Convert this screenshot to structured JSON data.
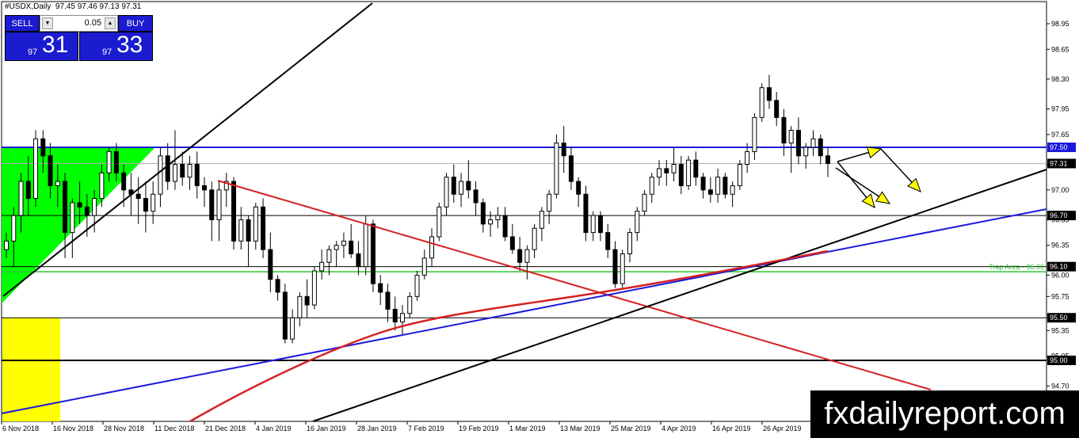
{
  "header": {
    "symbol": "#USDX,Daily",
    "ohlc": "97.45 97.46 97.13 97.31"
  },
  "trade_panel": {
    "sell_label": "SELL",
    "buy_label": "BUY",
    "lot_value": "0.05",
    "sell_price_prefix": "97",
    "sell_price_big": "31",
    "buy_price_prefix": "97",
    "buy_price_big": "33"
  },
  "brand": "fxdailyreport.com",
  "colors": {
    "bull_candle": "#ffffff",
    "bear_candle": "#000000",
    "resistance_line": "#1a1adb",
    "ma_line": "#d42020",
    "trendline": "#000000",
    "green_zone": "#00ff00",
    "yellow_zone": "#ffff00",
    "arrow_fill": "#ffff00"
  },
  "chart_data": {
    "type": "candlestick",
    "symbol": "#USDX",
    "timeframe": "Daily",
    "y_ticks": [
      "98.95",
      "98.65",
      "98.30",
      "97.95",
      "97.65",
      "97.30",
      "97.00",
      "96.65",
      "96.35",
      "96.00",
      "95.75",
      "95.35",
      "95.05",
      "94.70"
    ],
    "y_tick_values": [
      98.95,
      98.65,
      98.3,
      97.95,
      97.65,
      97.3,
      97.0,
      96.65,
      96.35,
      96.0,
      95.75,
      95.35,
      95.05,
      94.7
    ],
    "ylim": [
      94.6,
      99.25
    ],
    "x_ticks": [
      "6 Nov 2018",
      "16 Nov 2018",
      "28 Nov 2018",
      "11 Dec 2018",
      "21 Dec 2018",
      "4 Jan 2019",
      "16 Jan 2019",
      "28 Jan 2019",
      "7 Feb 2019",
      "19 Feb 2019",
      "1 Mar 2019",
      "13 Mar 2019",
      "25 Mar 2019",
      "4 Apr 2019",
      "16 Apr 2019",
      "26 Apr 2019"
    ],
    "price_tags": [
      {
        "label": "97.50",
        "value": 97.5,
        "color": "#1a1adb"
      },
      {
        "label": "97.31",
        "value": 97.31,
        "color": "#000000"
      },
      {
        "label": "96.70",
        "value": 96.7,
        "color": "#000000"
      },
      {
        "label": "96.10",
        "value": 96.1,
        "color": "#000000"
      },
      {
        "label": "95.50",
        "value": 95.5,
        "color": "#000000"
      },
      {
        "label": "95.00",
        "value": 95.0,
        "color": "#000000"
      }
    ],
    "trap_label": "Trap Area - 96.00",
    "trap_level": 96.04,
    "candles": [
      [
        96.3,
        96.5,
        96.2,
        96.4
      ],
      [
        96.4,
        96.8,
        96.1,
        96.7
      ],
      [
        96.7,
        97.2,
        96.5,
        97.1
      ],
      [
        97.1,
        97.4,
        96.7,
        96.9
      ],
      [
        96.9,
        97.7,
        96.8,
        97.6
      ],
      [
        97.6,
        97.7,
        97.2,
        97.4
      ],
      [
        97.4,
        97.55,
        96.9,
        97.05
      ],
      [
        97.05,
        97.3,
        96.8,
        97.1
      ],
      [
        97.1,
        97.2,
        96.2,
        96.5
      ],
      [
        96.5,
        96.9,
        96.2,
        96.85
      ],
      [
        96.85,
        97.1,
        96.6,
        96.8
      ],
      [
        96.8,
        96.95,
        96.45,
        96.7
      ],
      [
        96.7,
        97.0,
        96.5,
        96.9
      ],
      [
        96.9,
        97.3,
        96.8,
        97.2
      ],
      [
        97.2,
        97.5,
        97.1,
        97.45
      ],
      [
        97.45,
        97.55,
        97.1,
        97.2
      ],
      [
        97.2,
        97.3,
        96.8,
        97.0
      ],
      [
        97.0,
        97.2,
        96.7,
        96.95
      ],
      [
        96.95,
        97.15,
        96.6,
        96.9
      ],
      [
        96.9,
        97.1,
        96.5,
        96.75
      ],
      [
        96.75,
        97.1,
        96.6,
        96.95
      ],
      [
        96.95,
        97.5,
        96.8,
        97.4
      ],
      [
        97.4,
        97.55,
        97.0,
        97.1
      ],
      [
        97.1,
        97.7,
        97.0,
        97.3
      ],
      [
        97.3,
        97.45,
        97.05,
        97.15
      ],
      [
        97.15,
        97.4,
        97.0,
        97.3
      ],
      [
        97.3,
        97.45,
        96.9,
        97.05
      ],
      [
        97.05,
        97.15,
        96.8,
        97.0
      ],
      [
        97.0,
        97.1,
        96.4,
        96.65
      ],
      [
        96.65,
        97.1,
        96.4,
        97.0
      ],
      [
        97.0,
        97.2,
        96.8,
        97.1
      ],
      [
        97.1,
        97.15,
        96.3,
        96.4
      ],
      [
        96.4,
        96.8,
        96.3,
        96.65
      ],
      [
        96.65,
        96.7,
        96.1,
        96.4
      ],
      [
        96.4,
        96.85,
        96.3,
        96.8
      ],
      [
        96.8,
        96.9,
        96.2,
        96.3
      ],
      [
        96.3,
        96.5,
        95.8,
        95.95
      ],
      [
        95.95,
        96.0,
        95.7,
        95.8
      ],
      [
        95.8,
        95.9,
        95.2,
        95.25
      ],
      [
        95.25,
        95.6,
        95.2,
        95.5
      ],
      [
        95.5,
        95.8,
        95.4,
        95.75
      ],
      [
        95.75,
        95.95,
        95.5,
        95.65
      ],
      [
        95.65,
        96.1,
        95.6,
        96.05
      ],
      [
        96.05,
        96.3,
        95.95,
        96.15
      ],
      [
        96.15,
        96.35,
        96.0,
        96.3
      ],
      [
        96.3,
        96.4,
        96.1,
        96.35
      ],
      [
        96.35,
        96.5,
        96.2,
        96.4
      ],
      [
        96.4,
        96.6,
        96.2,
        96.25
      ],
      [
        96.25,
        96.4,
        96.0,
        96.1
      ],
      [
        96.1,
        96.7,
        96.0,
        96.6
      ],
      [
        96.6,
        96.65,
        95.8,
        95.9
      ],
      [
        95.9,
        96.0,
        95.65,
        95.8
      ],
      [
        95.8,
        95.9,
        95.45,
        95.6
      ],
      [
        95.6,
        95.75,
        95.35,
        95.45
      ],
      [
        95.45,
        95.65,
        95.3,
        95.55
      ],
      [
        95.55,
        95.8,
        95.5,
        95.75
      ],
      [
        95.75,
        96.05,
        95.7,
        96.0
      ],
      [
        96.0,
        96.3,
        95.95,
        96.2
      ],
      [
        96.2,
        96.55,
        96.1,
        96.45
      ],
      [
        96.45,
        96.85,
        96.4,
        96.8
      ],
      [
        96.8,
        97.2,
        96.7,
        97.15
      ],
      [
        97.15,
        97.3,
        96.85,
        96.95
      ],
      [
        96.95,
        97.2,
        96.8,
        97.1
      ],
      [
        97.1,
        97.35,
        96.9,
        97.0
      ],
      [
        97.0,
        97.1,
        96.7,
        96.85
      ],
      [
        96.85,
        96.9,
        96.5,
        96.6
      ],
      [
        96.6,
        96.75,
        96.45,
        96.65
      ],
      [
        96.65,
        96.8,
        96.55,
        96.7
      ],
      [
        96.7,
        96.8,
        96.4,
        96.45
      ],
      [
        96.45,
        96.6,
        96.25,
        96.3
      ],
      [
        96.3,
        96.45,
        96.05,
        96.15
      ],
      [
        96.15,
        96.35,
        95.95,
        96.3
      ],
      [
        96.3,
        96.6,
        96.2,
        96.55
      ],
      [
        96.55,
        96.8,
        96.4,
        96.75
      ],
      [
        96.75,
        97.0,
        96.6,
        96.95
      ],
      [
        96.95,
        97.65,
        96.9,
        97.55
      ],
      [
        97.55,
        97.75,
        97.2,
        97.4
      ],
      [
        97.4,
        97.5,
        97.0,
        97.1
      ],
      [
        97.1,
        97.15,
        96.8,
        96.95
      ],
      [
        96.95,
        97.05,
        96.4,
        96.5
      ],
      [
        96.5,
        96.75,
        96.4,
        96.7
      ],
      [
        96.7,
        96.75,
        96.4,
        96.5
      ],
      [
        96.5,
        96.6,
        96.2,
        96.3
      ],
      [
        96.3,
        96.4,
        95.85,
        95.9
      ],
      [
        95.9,
        96.3,
        95.85,
        96.25
      ],
      [
        96.25,
        96.55,
        96.15,
        96.5
      ],
      [
        96.5,
        96.8,
        96.4,
        96.75
      ],
      [
        96.75,
        97.0,
        96.7,
        96.95
      ],
      [
        96.95,
        97.2,
        96.85,
        97.15
      ],
      [
        97.15,
        97.35,
        97.05,
        97.25
      ],
      [
        97.25,
        97.35,
        97.05,
        97.2
      ],
      [
        97.2,
        97.5,
        97.1,
        97.3
      ],
      [
        97.3,
        97.4,
        96.95,
        97.05
      ],
      [
        97.05,
        97.4,
        97.0,
        97.35
      ],
      [
        97.35,
        97.45,
        97.05,
        97.15
      ],
      [
        97.15,
        97.2,
        96.9,
        97.0
      ],
      [
        97.0,
        97.15,
        96.85,
        96.95
      ],
      [
        96.95,
        97.25,
        96.85,
        97.15
      ],
      [
        97.15,
        97.2,
        96.9,
        96.95
      ],
      [
        96.95,
        97.1,
        96.8,
        97.05
      ],
      [
        97.05,
        97.35,
        97.0,
        97.3
      ],
      [
        97.3,
        97.55,
        97.2,
        97.45
      ],
      [
        97.45,
        97.9,
        97.35,
        97.85
      ],
      [
        97.85,
        98.25,
        97.8,
        98.2
      ],
      [
        98.2,
        98.35,
        97.95,
        98.05
      ],
      [
        98.05,
        98.15,
        97.75,
        97.85
      ],
      [
        97.85,
        97.95,
        97.4,
        97.55
      ],
      [
        97.55,
        97.75,
        97.2,
        97.7
      ],
      [
        97.7,
        97.85,
        97.3,
        97.4
      ],
      [
        97.4,
        97.55,
        97.25,
        97.5
      ],
      [
        97.5,
        97.7,
        97.4,
        97.6
      ],
      [
        97.6,
        97.65,
        97.3,
        97.4
      ],
      [
        97.4,
        97.5,
        97.15,
        97.31
      ]
    ]
  }
}
